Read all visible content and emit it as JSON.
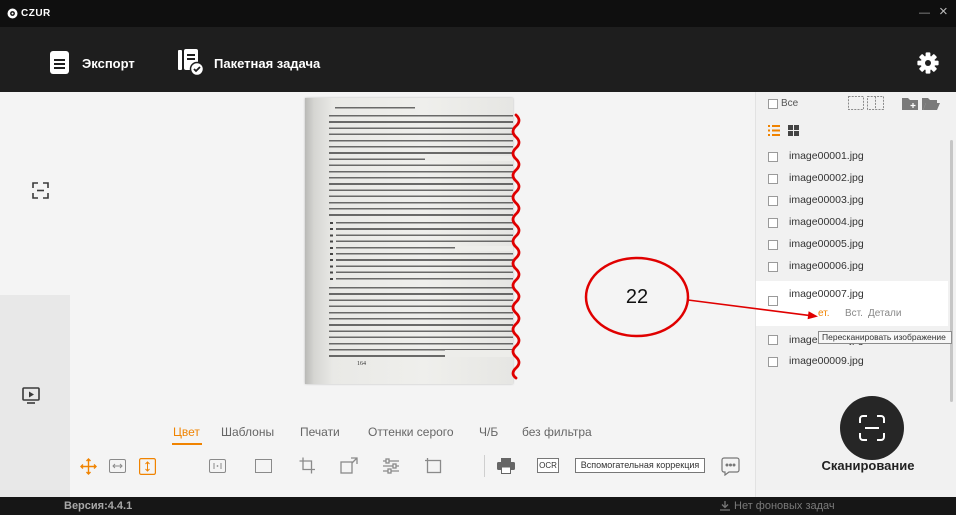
{
  "window": {
    "logo_text": "CZUR",
    "minimize_glyph": "—",
    "close_glyph": "×"
  },
  "toolbar": {
    "export": {
      "label": "Экспорт",
      "icon": "document-icon"
    },
    "batch": {
      "label": "Пакетная задача",
      "icon": "batch-task-icon"
    },
    "settings_icon": "gear-icon"
  },
  "sidebar": {
    "icons": [
      "crop-frame-icon",
      "slideshow-icon"
    ]
  },
  "document": {
    "page_number": "164"
  },
  "annotation": {
    "callout_number": "22"
  },
  "filters": {
    "tabs": [
      {
        "label": "Цвет",
        "active": true
      },
      {
        "label": "Шаблоны",
        "active": false
      },
      {
        "label": "Печати",
        "active": false
      },
      {
        "label": "Оттенки серого",
        "active": false
      },
      {
        "label": "Ч/Б",
        "active": false
      },
      {
        "label": "без фильтра",
        "active": false
      }
    ]
  },
  "tools": {
    "icons": [
      "move-icon",
      "fit-width-icon",
      "fit-height-icon",
      "split-page-icon",
      "frame-icon",
      "crop-icon",
      "rotate-crop-icon",
      "adjust-icon",
      "rectangle-icon",
      "print-icon",
      "feedback-icon"
    ],
    "active_icons": [
      "move-icon",
      "fit-height-icon"
    ],
    "ocr_label": "OCR",
    "assist_label": "Вспомогательная коррекция"
  },
  "file_panel": {
    "select_all_label": "Все",
    "active_view_icon": "list-view-icon",
    "files": [
      {
        "name": "image00001.jpg",
        "checked": false
      },
      {
        "name": "image00002.jpg",
        "checked": false
      },
      {
        "name": "image00003.jpg",
        "checked": false
      },
      {
        "name": "image00004.jpg",
        "checked": false
      },
      {
        "name": "image00005.jpg",
        "checked": false
      },
      {
        "name": "image00006.jpg",
        "checked": false
      },
      {
        "name": "image00007.jpg",
        "checked": false,
        "selected": true
      },
      {
        "name": "image00008.jpg",
        "checked": false
      },
      {
        "name": "image00009.jpg",
        "checked": false
      }
    ],
    "selected_actions": [
      "ет.",
      "Вст.",
      "Детали"
    ],
    "tooltip": "Пересканировать изображение"
  },
  "scan": {
    "label": "Сканирование"
  },
  "statusbar": {
    "version": "Версия:4.4.1",
    "tasks": "Нет фоновых задач"
  },
  "colors": {
    "accent": "#f08300",
    "annotation": "#e00000",
    "titlebar": "#0f0f0f",
    "toolbar": "#1e1e1e",
    "scan_button": "#262626"
  }
}
